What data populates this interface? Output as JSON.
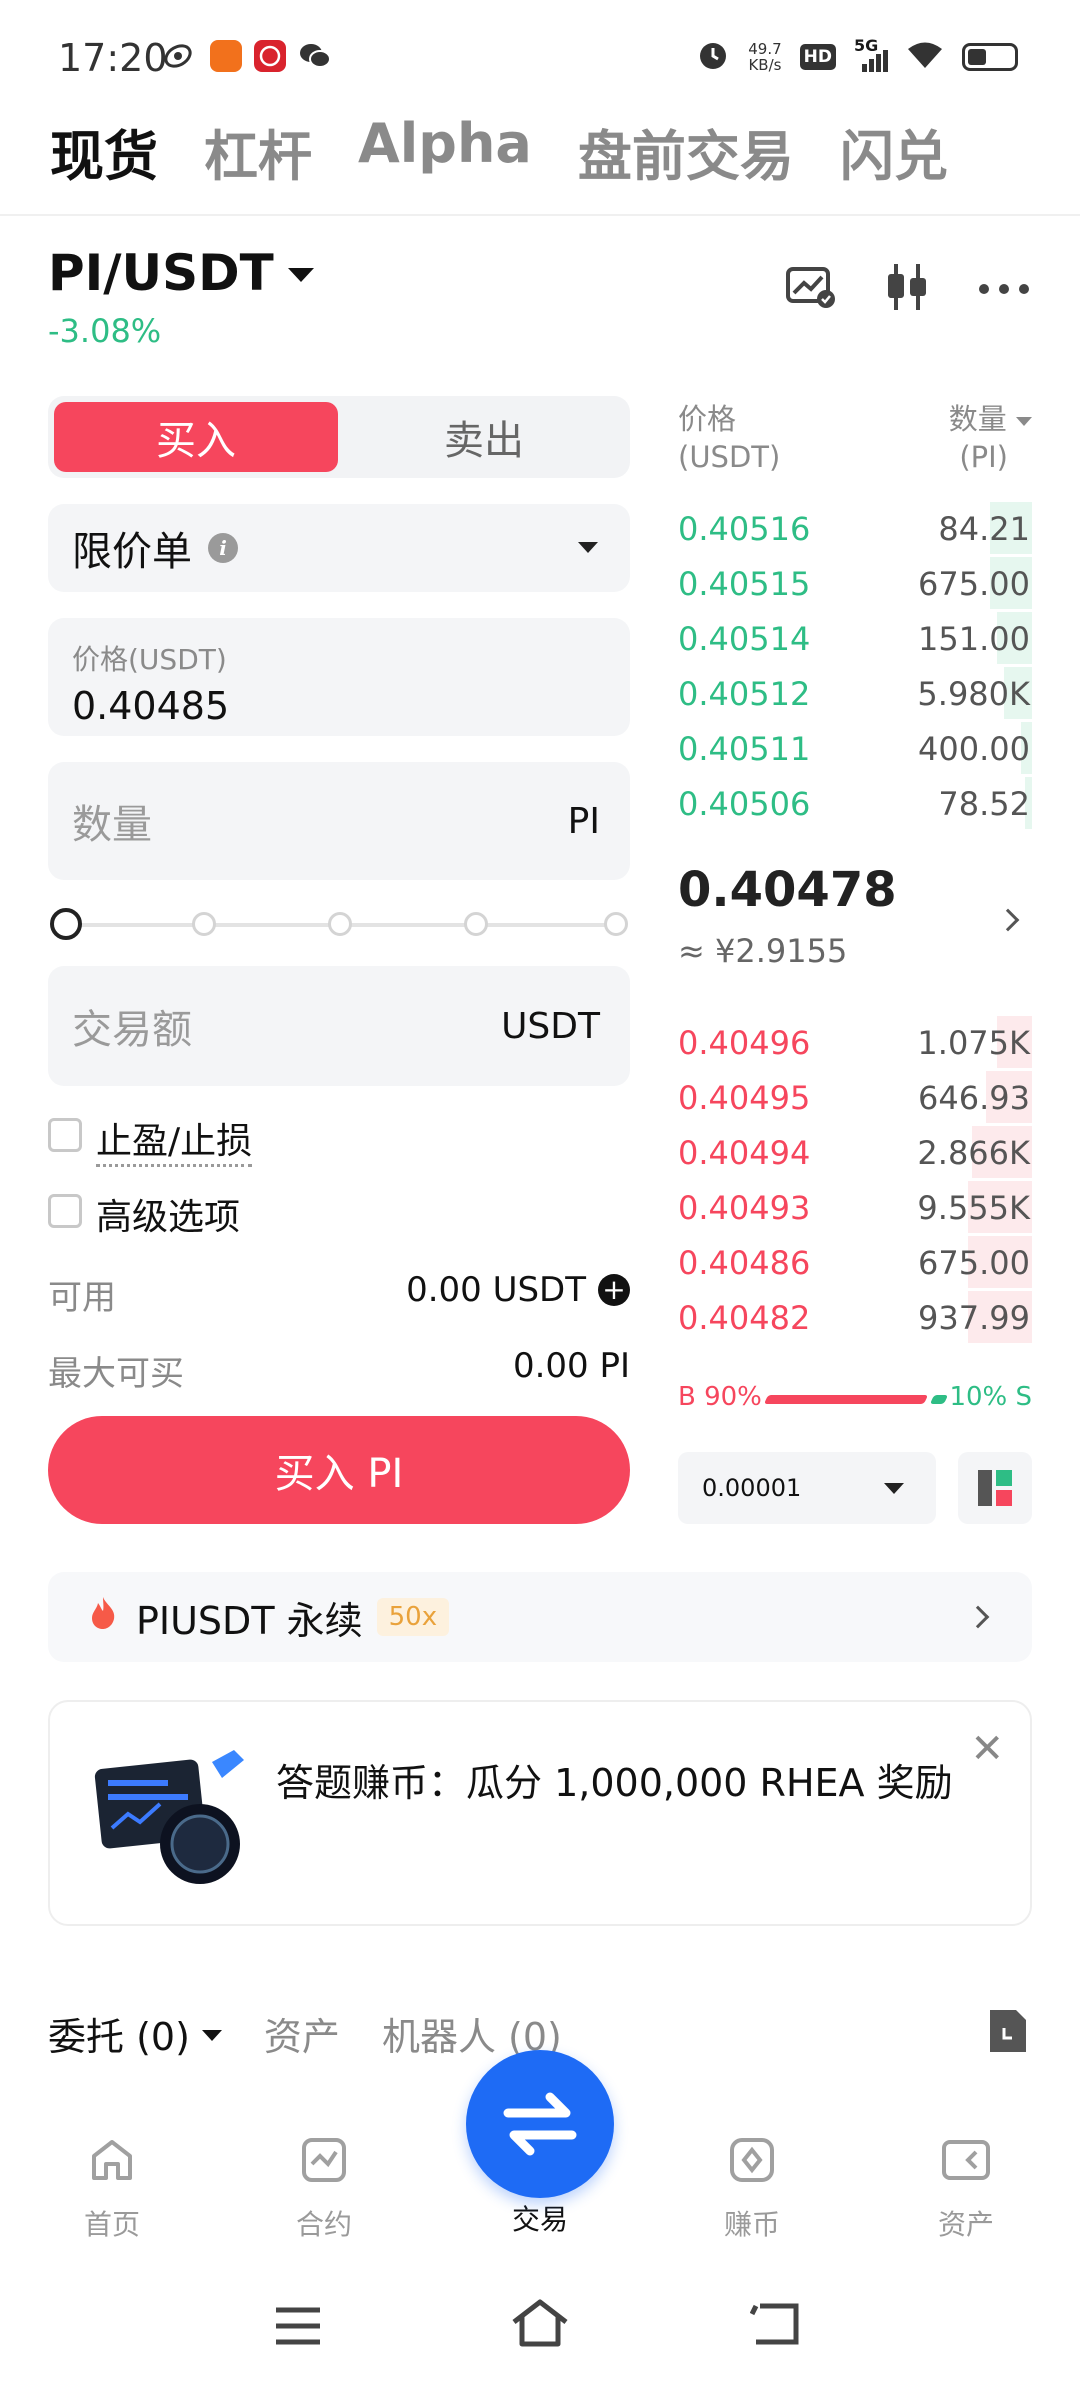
{
  "status_bar": {
    "time": "17:20",
    "net_speed_value": "49.7",
    "net_speed_unit": "KB/s",
    "network": "5G",
    "hd": "HD"
  },
  "top_tabs": [
    "现货",
    "杠杆",
    "Alpha",
    "盘前交易",
    "闪兑"
  ],
  "pair": {
    "name": "PI/USDT",
    "change": "-3.08%"
  },
  "trade_form": {
    "buy_tab": "买入",
    "sell_tab": "卖出",
    "order_type": "限价单",
    "price_label": "价格(USDT)",
    "price_value": "0.40485",
    "qty_placeholder": "数量",
    "qty_unit": "PI",
    "amount_placeholder": "交易额",
    "amount_unit": "USDT",
    "tp_sl_label": "止盈/止损",
    "advanced_label": "高级选项",
    "available_label": "可用",
    "available_value": "0.00 USDT",
    "max_buy_label": "最大可买",
    "max_buy_value": "0.00 PI",
    "submit_label": "买入 PI"
  },
  "order_book": {
    "price_header": "价格",
    "price_unit": "(USDT)",
    "qty_header": "数量",
    "qty_unit": "(PI)",
    "asks": [
      {
        "price": "0.40516",
        "qty": "84.21",
        "depth": 0.12
      },
      {
        "price": "0.40515",
        "qty": "675.00",
        "depth": 0.12
      },
      {
        "price": "0.40514",
        "qty": "151.00",
        "depth": 0.1
      },
      {
        "price": "0.40512",
        "qty": "5.980K",
        "depth": 0.08
      },
      {
        "price": "0.40511",
        "qty": "400.00",
        "depth": 0.03
      },
      {
        "price": "0.40506",
        "qty": "78.52",
        "depth": 0.02
      }
    ],
    "last_price": "0.40478",
    "last_price_cny": "≈ ¥2.9155",
    "bids": [
      {
        "price": "0.40496",
        "qty": "1.075K",
        "depth": 0.1
      },
      {
        "price": "0.40495",
        "qty": "646.93",
        "depth": 0.13
      },
      {
        "price": "0.40494",
        "qty": "2.866K",
        "depth": 0.17
      },
      {
        "price": "0.40493",
        "qty": "9.555K",
        "depth": 0.18
      },
      {
        "price": "0.40486",
        "qty": "675.00",
        "depth": 0.18
      },
      {
        "price": "0.40482",
        "qty": "937.99",
        "depth": 0.18
      }
    ],
    "buy_ratio_label": "B 90%",
    "sell_ratio_label": "10% S",
    "buy_ratio": 0.9,
    "precision": "0.00001"
  },
  "futures_banner": {
    "label": "PIUSDT 永续",
    "leverage": "50x"
  },
  "promo": {
    "text": "答题赚币：瓜分 1,000,000 RHEA 奖励"
  },
  "order_tabs": {
    "orders": "委托 (0)",
    "assets": "资产",
    "bots": "机器人 (0)"
  },
  "bottom_nav": [
    "首页",
    "合约",
    "交易",
    "赚币",
    "资产"
  ],
  "colors": {
    "buy_red": "#f6465d",
    "up_green": "#2ebd85",
    "fab_blue": "#1e6bf5"
  }
}
